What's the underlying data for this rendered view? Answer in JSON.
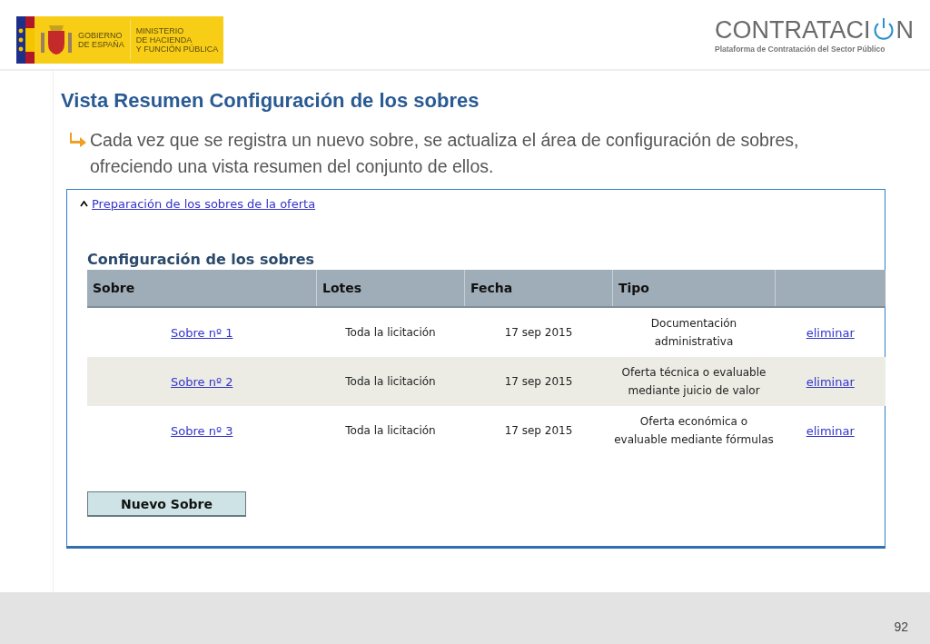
{
  "header": {
    "logo": {
      "government": [
        "GOBIERNO",
        "DE ESPAÑA"
      ],
      "ministry": [
        "MINISTERIO",
        "DE HACIENDA",
        "Y FUNCIÓN PÚBLICA"
      ]
    },
    "brand": {
      "name_start": "CONTRATACI",
      "name_end": "N",
      "subtitle": "Plataforma de Contratación del Sector Público"
    }
  },
  "title": "Vista Resumen Configuración de los sobres",
  "bullet": "Cada vez que se registra un nuevo sobre, se actualiza el área de configuración de sobres, ofreciendo una vista resumen del conjunto de ellos.",
  "panel": {
    "section_link": "Preparación de los sobres de la oferta",
    "expanded": true,
    "heading": "Configuración de los sobres",
    "table": {
      "columns": [
        "Sobre",
        "Lotes",
        "Fecha",
        "Tipo"
      ],
      "rows": [
        {
          "sobre": "Sobre nº 1",
          "lotes": "Toda la licitación",
          "fecha": "17 sep 2015",
          "tipo": "Documentación administrativa",
          "action": "eliminar"
        },
        {
          "sobre": "Sobre nº 2",
          "lotes": "Toda la licitación",
          "fecha": "17 sep 2015",
          "tipo": "Oferta técnica o evaluable mediante juicio de valor",
          "action": "eliminar"
        },
        {
          "sobre": "Sobre nº 3",
          "lotes": "Toda la licitación",
          "fecha": "17 sep 2015",
          "tipo": "Oferta económica o evaluable mediante fórmulas",
          "action": "eliminar"
        }
      ]
    },
    "button": "Nuevo Sobre"
  },
  "page_number": "92"
}
